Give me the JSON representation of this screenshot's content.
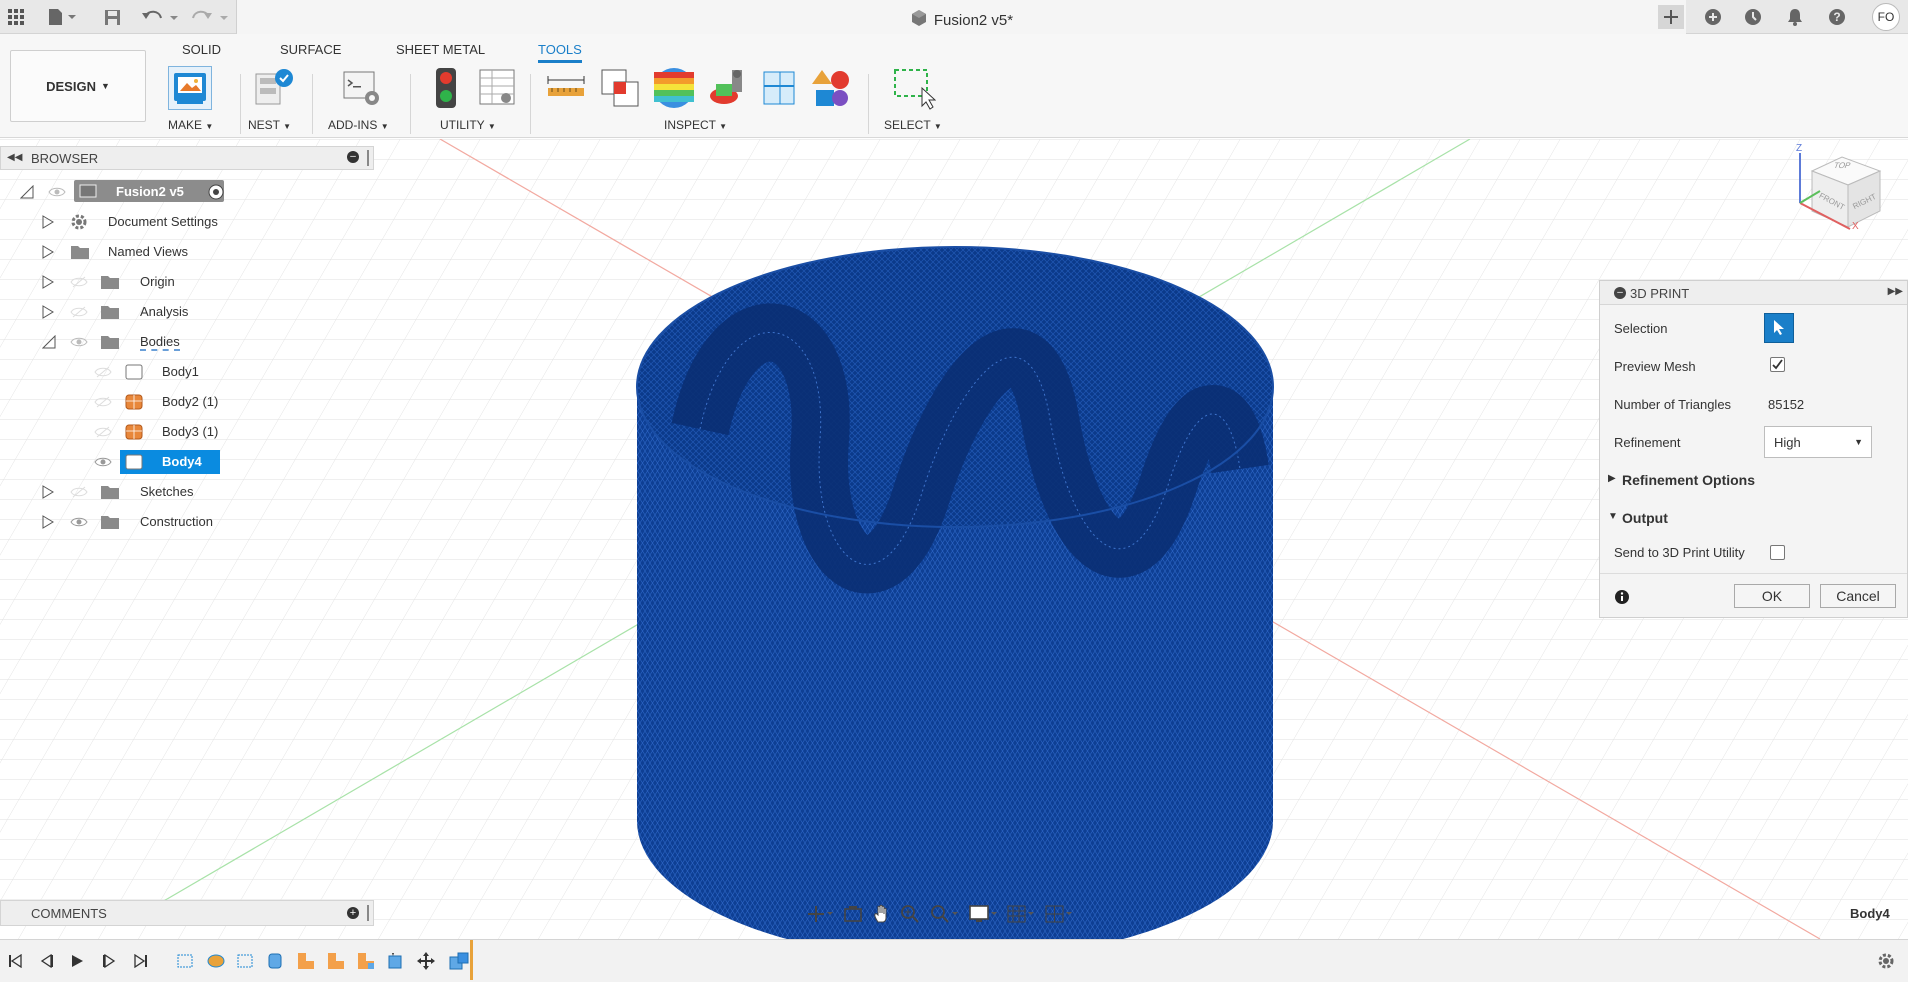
{
  "app": {
    "document_title": "Fusion2 v5*",
    "user_initials": "FO"
  },
  "ribbon": {
    "workspace": "DESIGN",
    "tabs": [
      "SOLID",
      "SURFACE",
      "SHEET METAL",
      "TOOLS"
    ],
    "active_tab": "TOOLS",
    "groups": {
      "make": "MAKE",
      "nest": "NEST",
      "addins": "ADD-INS",
      "utility": "UTILITY",
      "inspect": "INSPECT",
      "select": "SELECT"
    }
  },
  "browser": {
    "title": "BROWSER",
    "root": "Fusion2 v5",
    "items": [
      {
        "label": "Document Settings"
      },
      {
        "label": "Named Views"
      },
      {
        "label": "Origin"
      },
      {
        "label": "Analysis"
      },
      {
        "label": "Bodies"
      },
      {
        "label": "Body1"
      },
      {
        "label": "Body2 (1)"
      },
      {
        "label": "Body3 (1)"
      },
      {
        "label": "Body4"
      },
      {
        "label": "Sketches"
      },
      {
        "label": "Construction"
      }
    ]
  },
  "viewcube": {
    "top": "TOP",
    "front": "FRONT",
    "right": "RIGHT",
    "z_axis": "Z",
    "x_axis": "X"
  },
  "print_panel": {
    "title": "3D PRINT",
    "selection_label": "Selection",
    "preview_mesh_label": "Preview Mesh",
    "preview_mesh_checked": true,
    "triangles_label": "Number of Triangles",
    "triangles_value": "85152",
    "refinement_label": "Refinement",
    "refinement_value": "High",
    "refinement_options": "Refinement Options",
    "output": "Output",
    "send_label": "Send to 3D Print Utility",
    "send_checked": false,
    "ok": "OK",
    "cancel": "Cancel"
  },
  "comments": {
    "title": "COMMENTS"
  },
  "status": {
    "selected_body": "Body4"
  },
  "colors": {
    "accent": "#1a7fc9",
    "mesh": "#0b3a8a",
    "selection": "#0a8be0"
  }
}
